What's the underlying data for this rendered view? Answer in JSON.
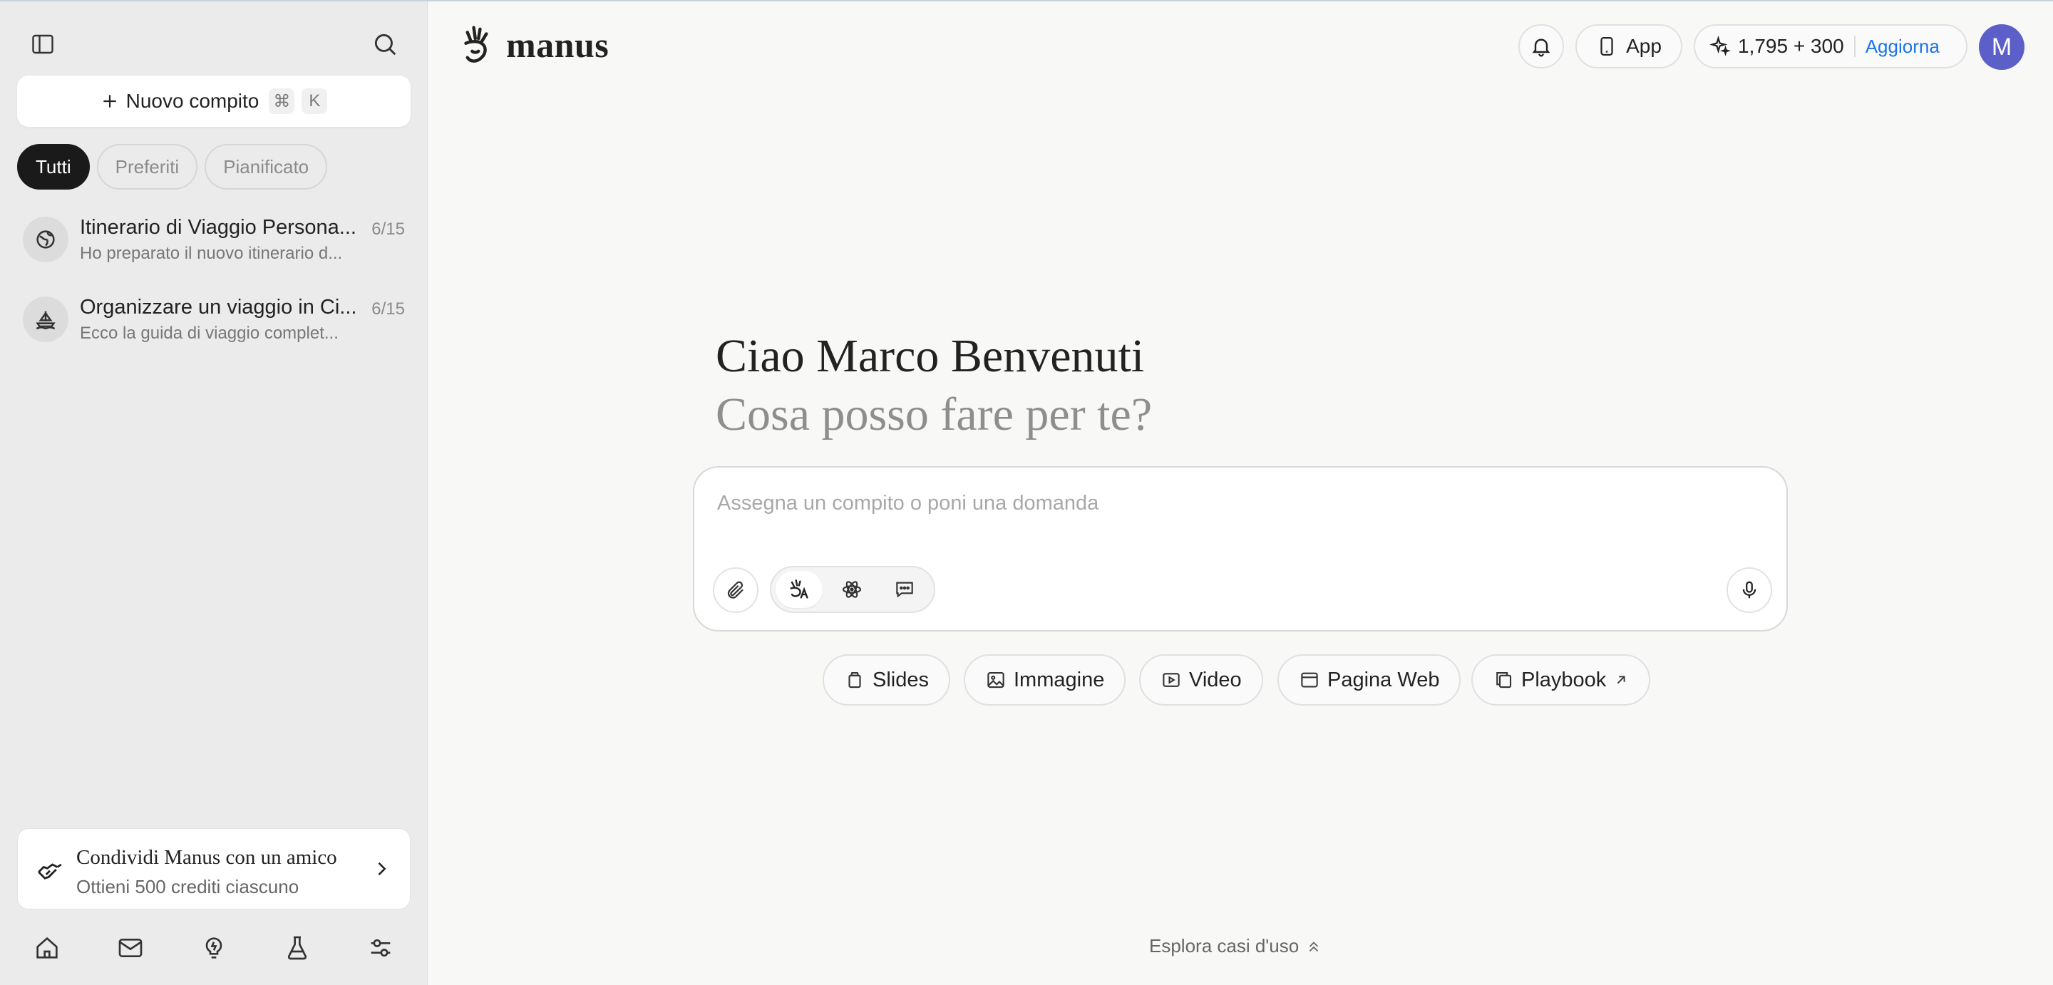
{
  "sidebar": {
    "new_task_label": "Nuovo compito",
    "shortcut_cmd": "⌘",
    "shortcut_key": "K",
    "filters": [
      "Tutti",
      "Preferiti",
      "Pianificato"
    ],
    "tasks": [
      {
        "title": "Itinerario di Viaggio Persona...",
        "subtitle": "Ho preparato il nuovo itinerario d...",
        "date": "6/15",
        "icon": "globe-icon"
      },
      {
        "title": "Organizzare un viaggio in Ci...",
        "subtitle": "Ecco la guida di viaggio complet...",
        "date": "6/15",
        "icon": "ship-icon"
      }
    ],
    "share": {
      "title": "Condividi Manus con un amico",
      "subtitle": "Ottieni 500 crediti ciascuno"
    }
  },
  "header": {
    "logo_text": "manus",
    "app_label": "App",
    "credits": "1,795 + 300",
    "upgrade_label": "Aggiorna",
    "avatar_initial": "M"
  },
  "main": {
    "greeting": "Ciao Marco Benvenuti",
    "question": "Cosa posso fare per te?",
    "input_placeholder": "Assegna un compito o poni una domanda",
    "quick_actions": [
      "Slides",
      "Immagine",
      "Video",
      "Pagina Web",
      "Playbook"
    ],
    "explore_label": "Esplora casi d'uso"
  },
  "colors": {
    "accent": "#1a73e8",
    "avatar": "#5b5fc7",
    "active_chip": "#1a1a1a"
  }
}
